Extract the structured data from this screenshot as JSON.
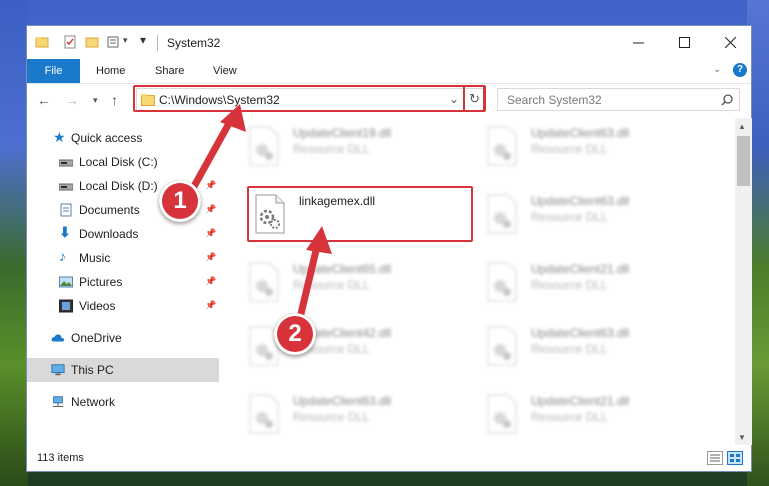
{
  "window": {
    "title": "System32"
  },
  "ribbon": {
    "tabs": [
      "File",
      "Home",
      "Share",
      "View"
    ]
  },
  "address": {
    "path": "C:\\Windows\\System32",
    "search_placeholder": "Search System32"
  },
  "sidebar": {
    "items": [
      {
        "label": "Quick access",
        "icon": "star-icon",
        "pinned": false
      },
      {
        "label": "Local Disk (C:)",
        "icon": "drive-icon",
        "pinned": true
      },
      {
        "label": "Local Disk (D:)",
        "icon": "drive-icon",
        "pinned": true
      },
      {
        "label": "Documents",
        "icon": "documents-icon",
        "pinned": true
      },
      {
        "label": "Downloads",
        "icon": "download-icon",
        "pinned": true
      },
      {
        "label": "Music",
        "icon": "music-icon",
        "pinned": true
      },
      {
        "label": "Pictures",
        "icon": "pictures-icon",
        "pinned": true
      },
      {
        "label": "Videos",
        "icon": "videos-icon",
        "pinned": true
      },
      {
        "label": "OneDrive",
        "icon": "cloud-icon",
        "pinned": false
      },
      {
        "label": "This PC",
        "icon": "computer-icon",
        "pinned": false,
        "selected": true
      },
      {
        "label": "Network",
        "icon": "network-icon",
        "pinned": false
      }
    ]
  },
  "files": [
    {
      "name": "UpdateClient19.dll",
      "type": "Resource DLL",
      "blurred": true
    },
    {
      "name": "UpdateClient63.dll",
      "type": "Resource DLL",
      "blurred": true
    },
    {
      "name": "linkagemex.dll",
      "type": "",
      "blurred": false
    },
    {
      "name": "UpdateClient63.dll",
      "type": "Resource DLL",
      "blurred": true
    },
    {
      "name": "UpdateClient65.dll",
      "type": "Resource DLL",
      "blurred": true
    },
    {
      "name": "UpdateClient21.dll",
      "type": "Resource DLL",
      "blurred": true
    },
    {
      "name": "UpdateClient42.dll",
      "type": "Resource DLL",
      "blurred": true
    },
    {
      "name": "UpdateClient63.dll",
      "type": "Resource DLL",
      "blurred": true
    },
    {
      "name": "UpdateClient63.dll",
      "type": "Resource DLL",
      "blurred": true
    },
    {
      "name": "UpdateClient21.dll",
      "type": "Resource DLL",
      "blurred": true
    }
  ],
  "status": {
    "item_count": "113 items"
  },
  "annotations": {
    "step1": "1",
    "step2": "2",
    "color": "#d7333a"
  }
}
